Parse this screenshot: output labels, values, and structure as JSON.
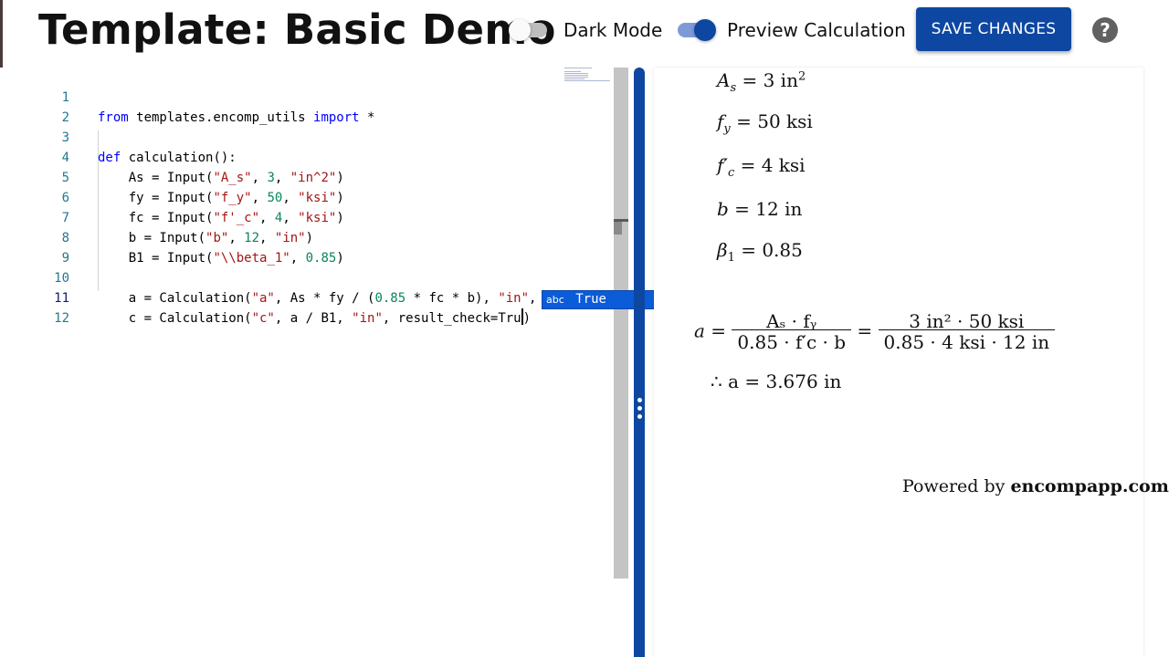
{
  "header": {
    "title": "Template: Basic Demo",
    "dark_mode_label": "Dark Mode",
    "dark_mode_on": false,
    "preview_label": "Preview Calculation",
    "preview_on": true,
    "save_label": "SAVE CHANGES",
    "help_symbol": "?"
  },
  "colors": {
    "primary": "#0d47a1",
    "suggest_bg": "#0b5cd8"
  },
  "editor": {
    "active_line": 11,
    "lines": [
      {
        "n": "1"
      },
      {
        "n": "2"
      },
      {
        "n": "3"
      },
      {
        "n": "4"
      },
      {
        "n": "5"
      },
      {
        "n": "6"
      },
      {
        "n": "7"
      },
      {
        "n": "8"
      },
      {
        "n": "9"
      },
      {
        "n": "10"
      },
      {
        "n": "11"
      },
      {
        "n": "12"
      }
    ],
    "code": {
      "l1": {
        "kw1": "from",
        "mid": " templates.encomp_utils ",
        "kw2": "import",
        "end": " *"
      },
      "l3": {
        "kw": "def",
        "rest": " calculation():"
      },
      "l4": {
        "a": "    As = Input(",
        "s1": "\"A_s\"",
        "b": ", ",
        "n1": "3",
        "c": ", ",
        "s2": "\"in^2\"",
        "d": ")"
      },
      "l5": {
        "a": "    fy = Input(",
        "s1": "\"f_y\"",
        "b": ", ",
        "n1": "50",
        "c": ", ",
        "s2": "\"ksi\"",
        "d": ")"
      },
      "l6": {
        "a": "    fc = Input(",
        "s1": "\"f'_c\"",
        "b": ", ",
        "n1": "4",
        "c": ", ",
        "s2": "\"ksi\"",
        "d": ")"
      },
      "l7": {
        "a": "    b = Input(",
        "s1": "\"b\"",
        "b": ", ",
        "n1": "12",
        "c": ", ",
        "s2": "\"in\"",
        "d": ")"
      },
      "l8": {
        "a": "    B1 = Input(",
        "s1": "\"\\\\beta_1\"",
        "b": ", ",
        "n1": "0.85",
        "d": ")"
      },
      "l10": {
        "a": "    a = Calculation(",
        "s1": "\"a\"",
        "b": ", As * fy / (",
        "n1": "0.85",
        "c": " * fc * b), ",
        "s2": "\"in\"",
        "d": ","
      },
      "l11": {
        "a": "    c = Calculation(",
        "s1": "\"c\"",
        "b": ", a / B1, ",
        "s2": "\"in\"",
        "c": ", result_check=Tru",
        "d": ")"
      }
    },
    "suggestion": {
      "kind": "abc",
      "label": "True"
    }
  },
  "preview": {
    "inputs": [
      {
        "lhs": "A",
        "sub": "s",
        "rhs": "= 3 in",
        "sup": "2"
      },
      {
        "lhs": "f",
        "sub": "y",
        "rhs": "= 50 ksi"
      },
      {
        "lhs": "f′",
        "sub": "c",
        "rhs": "= 4 ksi"
      },
      {
        "lhs": "b",
        "rhs": "= 12 in"
      },
      {
        "lhs": "β",
        "sub": "1",
        "rhs": "= 0.85"
      }
    ],
    "calc": {
      "lhs": "a =",
      "num1": "Aₛ · fᵧ",
      "den1": "0.85 · f′c · b",
      "eq": "=",
      "num2": "3 in² · 50 ksi",
      "den2": "0.85 · 4 ksi · 12 in",
      "result": "∴ a = 3.676 in"
    },
    "footer_text": "Powered by ",
    "footer_brand": "encompapp.com"
  }
}
